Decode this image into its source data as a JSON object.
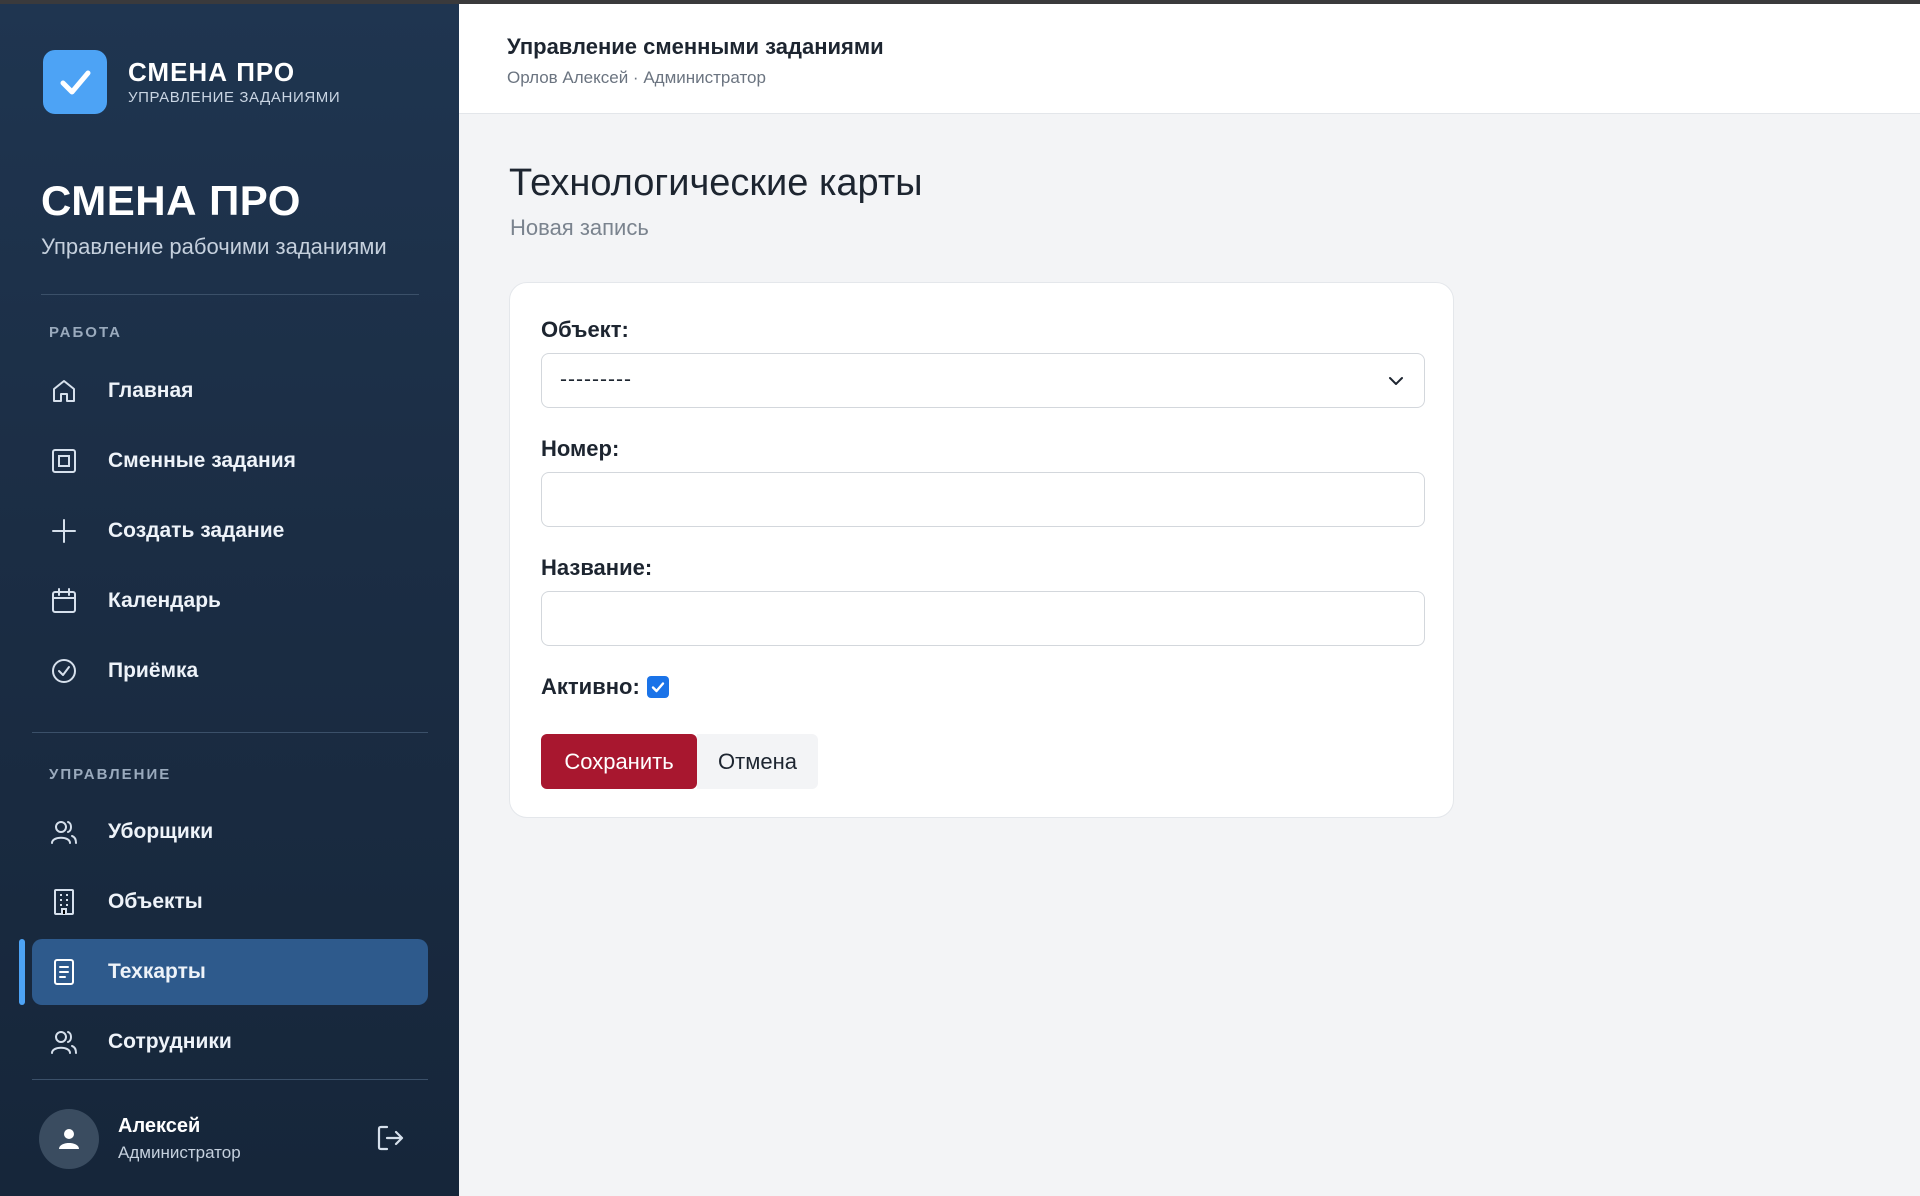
{
  "sidebar": {
    "logo": {
      "title": "СМЕНА ПРО",
      "subtitle": "УПРАВЛЕНИЕ ЗАДАНИЯМИ"
    },
    "brand": {
      "title": "СМЕНА ПРО",
      "subtitle": "Управление рабочими заданиями"
    },
    "sections": [
      {
        "label": "РАБОТА",
        "items": [
          {
            "label": "Главная",
            "icon": "home-icon"
          },
          {
            "label": "Сменные задания",
            "icon": "tasks-square-icon"
          },
          {
            "label": "Создать задание",
            "icon": "plus-icon"
          },
          {
            "label": "Календарь",
            "icon": "calendar-icon"
          },
          {
            "label": "Приёмка",
            "icon": "check-circle-icon"
          }
        ]
      },
      {
        "label": "УПРАВЛЕНИЕ",
        "items": [
          {
            "label": "Уборщики",
            "icon": "users-icon"
          },
          {
            "label": "Объекты",
            "icon": "building-icon"
          },
          {
            "label": "Техкарты",
            "icon": "document-icon",
            "active": true
          },
          {
            "label": "Сотрудники",
            "icon": "users-icon"
          }
        ]
      }
    ],
    "user": {
      "name": "Алексей",
      "role": "Администратор"
    }
  },
  "header": {
    "title": "Управление сменными заданиями",
    "subtitle": "Орлов Алексей · Администратор"
  },
  "page": {
    "title": "Технологические карты",
    "subtitle": "Новая запись"
  },
  "form": {
    "object_label": "Объект:",
    "object_value": "---------",
    "number_label": "Номер:",
    "number_value": "",
    "name_label": "Название:",
    "name_value": "",
    "active_label": "Активно:",
    "active_checked": true,
    "save_label": "Сохранить",
    "cancel_label": "Отмена"
  },
  "colors": {
    "sidebar_bg": "#1b2d44",
    "accent": "#4da3f5",
    "active_item": "#2e5a8c",
    "save_button": "#a8172f",
    "checkbox": "#1a73e8"
  }
}
